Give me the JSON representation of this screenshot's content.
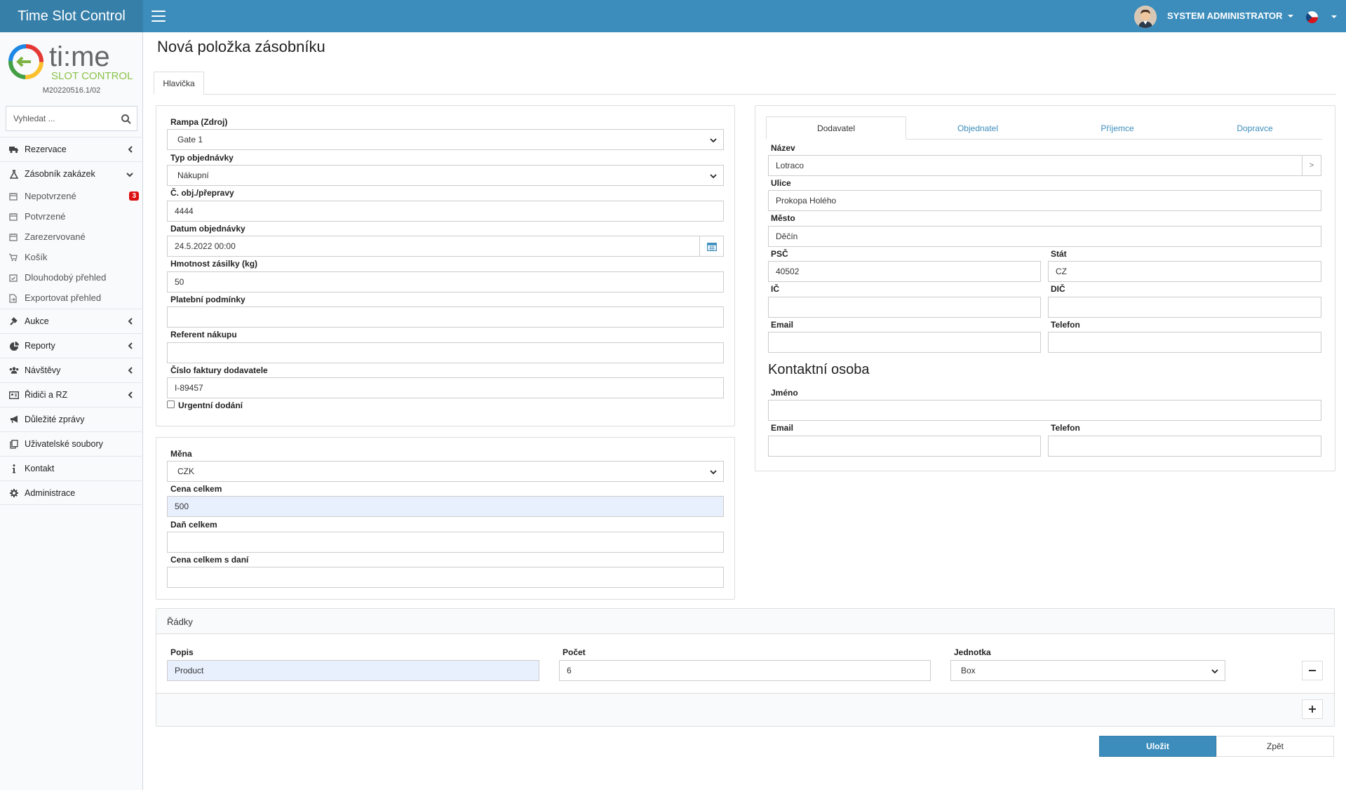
{
  "app": {
    "title": "Time Slot Control",
    "version": "M20220516.1/02"
  },
  "logo": {
    "text_main": "ti:me",
    "text_sub": "SLOT CONTROL"
  },
  "header": {
    "user": "SYSTEM ADMINISTRATOR"
  },
  "sidebar": {
    "search_placeholder": "Vyhledat ...",
    "items": [
      {
        "label": "Rezervace",
        "icon": "truck-icon"
      },
      {
        "label": "Zásobník zakázek",
        "icon": "flask-icon",
        "expanded": true
      },
      {
        "label": "Aukce",
        "icon": "gavel-icon"
      },
      {
        "label": "Reporty",
        "icon": "pie-chart-icon"
      },
      {
        "label": "Návštěvy",
        "icon": "users-icon"
      },
      {
        "label": "Řidiči a RZ",
        "icon": "id-card-icon"
      },
      {
        "label": "Důležité zprávy",
        "icon": "bullhorn-icon"
      },
      {
        "label": "Uživatelské soubory",
        "icon": "copy-icon"
      },
      {
        "label": "Kontakt",
        "icon": "info-icon"
      },
      {
        "label": "Administrace",
        "icon": "gear-icon"
      }
    ],
    "subitems": [
      {
        "label": "Nepotvrzené",
        "badge": "3"
      },
      {
        "label": "Potvrzené"
      },
      {
        "label": "Zarezervované"
      },
      {
        "label": "Košík"
      },
      {
        "label": "Dlouhodobý přehled"
      },
      {
        "label": "Exportovat přehled"
      }
    ]
  },
  "page": {
    "title": "Nová položka zásobníku",
    "tab": "Hlavička"
  },
  "form": {
    "rampa": {
      "label": "Rampa (Zdroj)",
      "value": "Gate 1"
    },
    "typ": {
      "label": "Typ objednávky",
      "value": "Nákupní"
    },
    "cislo": {
      "label": "Č. obj./přepravy",
      "value": "4444"
    },
    "datum": {
      "label": "Datum objednávky",
      "value": "24.5.2022 00:00"
    },
    "hmotnost": {
      "label": "Hmotnost zásilky (kg)",
      "value": "50"
    },
    "platebni": {
      "label": "Platební podmínky",
      "value": ""
    },
    "referent": {
      "label": "Referent nákupu",
      "value": ""
    },
    "faktura": {
      "label": "Číslo faktury dodavatele",
      "value": "I-89457"
    },
    "urgent": {
      "label": "Urgentní dodání"
    },
    "mena": {
      "label": "Měna",
      "value": "CZK"
    },
    "cena": {
      "label": "Cena celkem",
      "value": "500"
    },
    "dan": {
      "label": "Daň celkem",
      "value": ""
    },
    "cena_dan": {
      "label": "Cena celkem s daní",
      "value": ""
    }
  },
  "party": {
    "tabs": [
      "Dodavatel",
      "Objednatel",
      "Příjemce",
      "Dopravce"
    ],
    "nazev": {
      "label": "Název",
      "value": "Lotraco"
    },
    "ulice": {
      "label": "Ulice",
      "value": "Prokopa Holého"
    },
    "mesto": {
      "label": "Město",
      "value": "Děčín"
    },
    "psc": {
      "label": "PSČ",
      "value": "40502"
    },
    "stat": {
      "label": "Stát",
      "value": "CZ"
    },
    "ic": {
      "label": "IČ",
      "value": ""
    },
    "dic": {
      "label": "DIČ",
      "value": ""
    },
    "email": {
      "label": "Email",
      "value": ""
    },
    "telefon": {
      "label": "Telefon",
      "value": ""
    },
    "lookup_button": ">",
    "contact_heading": "Kontaktní osoba",
    "c_jmeno": {
      "label": "Jméno",
      "value": ""
    },
    "c_email": {
      "label": "Email",
      "value": ""
    },
    "c_telefon": {
      "label": "Telefon",
      "value": ""
    }
  },
  "lines": {
    "title": "Řádky",
    "headers": {
      "popis": "Popis",
      "pocet": "Počet",
      "jednotka": "Jednotka"
    },
    "rows": [
      {
        "popis": "Product",
        "pocet": "6",
        "jednotka": "Box"
      }
    ]
  },
  "buttons": {
    "save": "Uložit",
    "back": "Zpět"
  }
}
